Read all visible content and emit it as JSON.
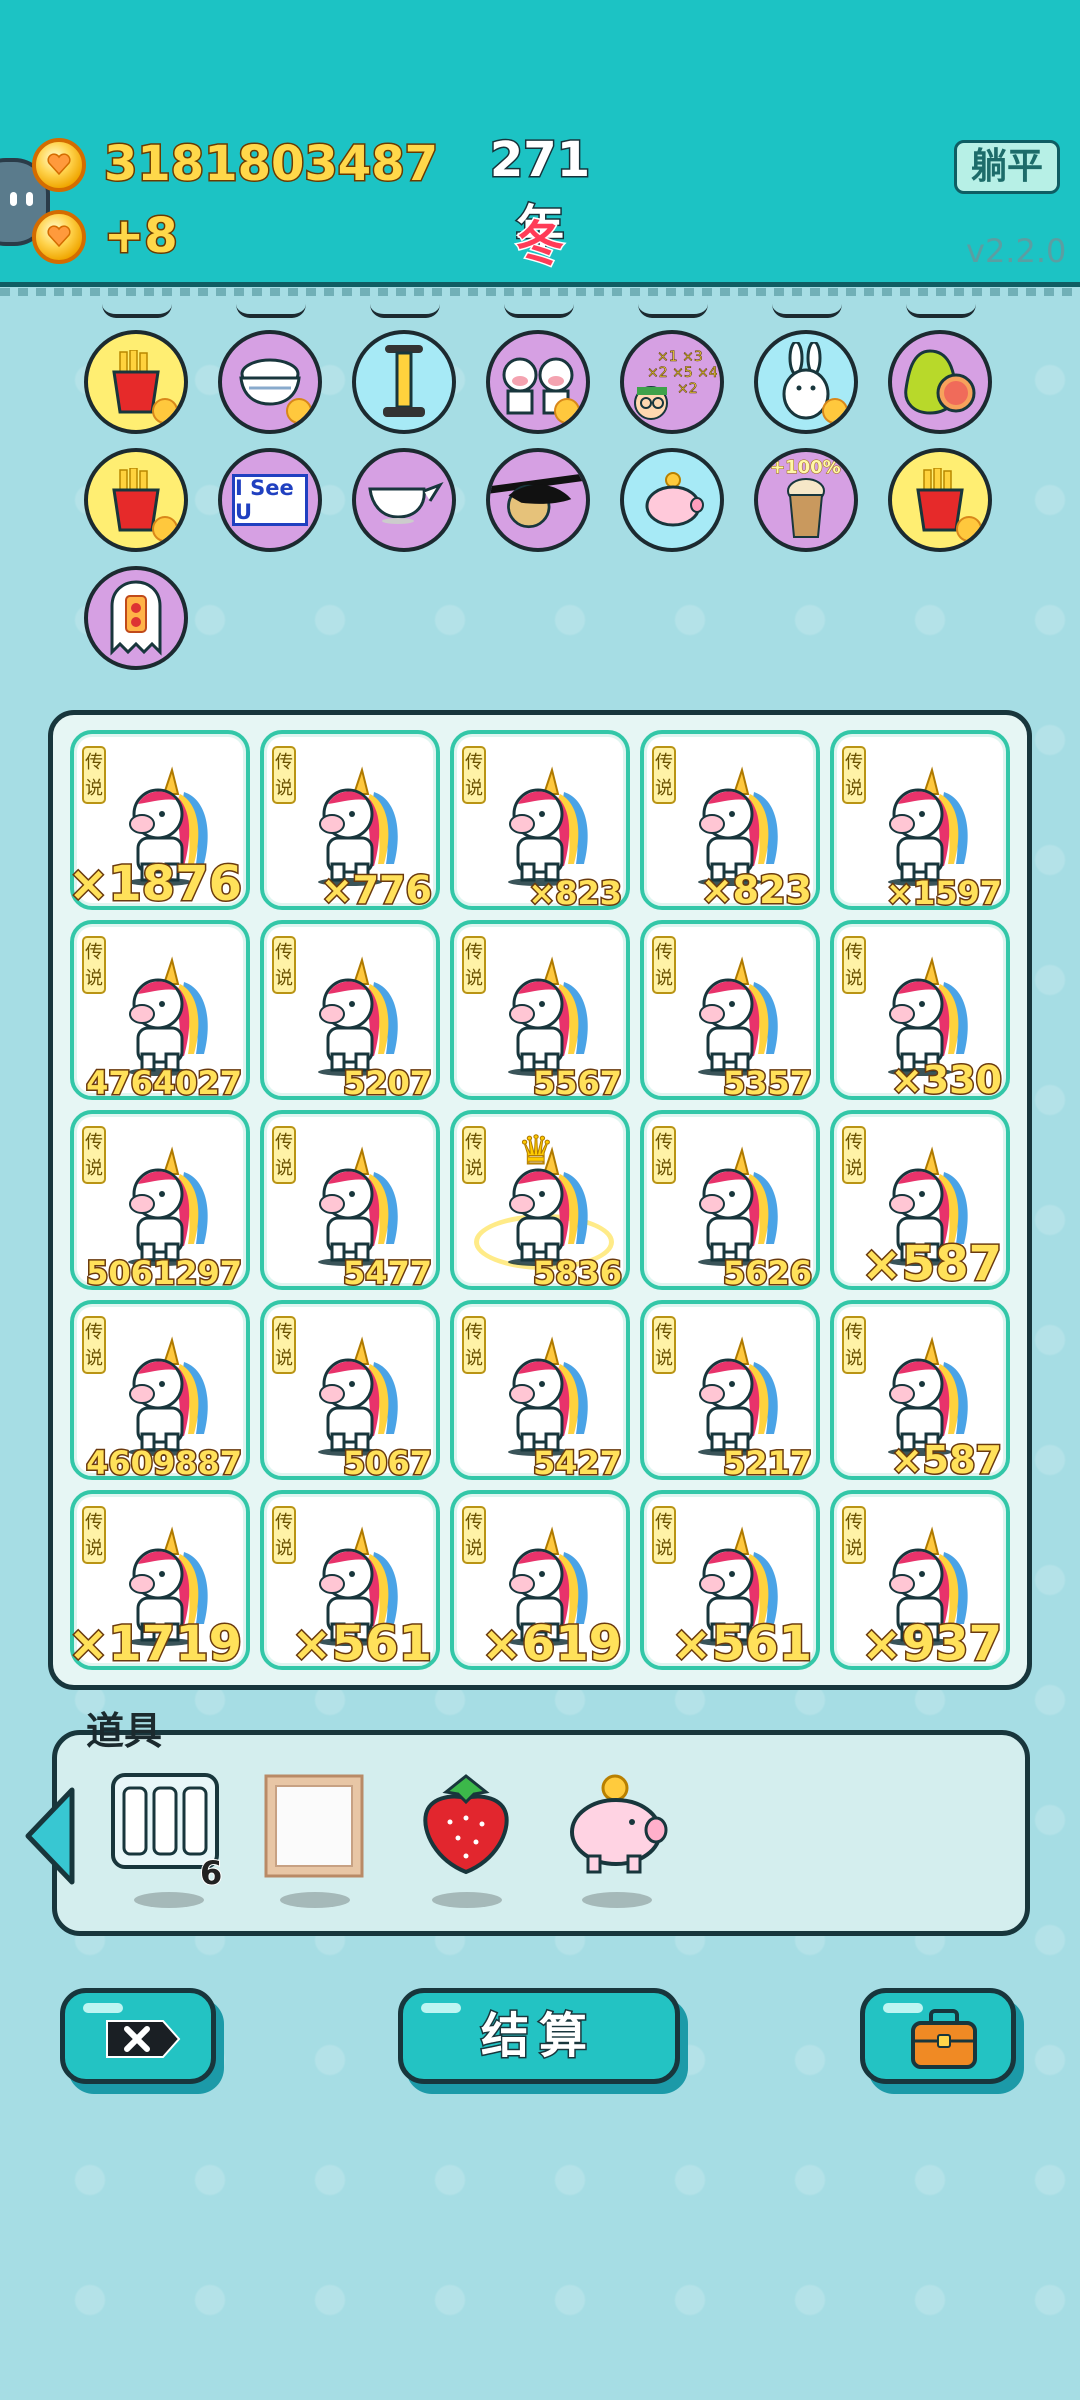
{
  "header": {
    "coins": "3181803487",
    "income": "+8",
    "year": "271年",
    "season": "冬",
    "lie_flat_button": "躺平",
    "version": "v2.2.0"
  },
  "buffs": [
    {
      "icon": "fries-icon",
      "color": "yellow",
      "heart": true
    },
    {
      "icon": "rice-bowl-icon",
      "color": "purple",
      "heart": true
    },
    {
      "icon": "air-pump-icon",
      "color": "blue",
      "heart": false
    },
    {
      "icon": "cow-couple-icon",
      "color": "purple",
      "heart": true
    },
    {
      "icon": "math-nerd-icon",
      "color": "purple",
      "heart": false
    },
    {
      "icon": "rabbit-icon",
      "color": "blue",
      "heart": true
    },
    {
      "icon": "pomelo-icon",
      "color": "purple",
      "heart": false
    },
    {
      "icon": "fries-icon",
      "color": "yellow",
      "heart": true
    },
    {
      "icon": "i-see-u-icon",
      "color": "purple",
      "heart": false,
      "text": "I See U"
    },
    {
      "icon": "gravy-boat-icon",
      "color": "purple",
      "heart": false
    },
    {
      "icon": "eyepatch-icon",
      "color": "purple",
      "heart": false
    },
    {
      "icon": "piggy-bank-icon",
      "color": "blue",
      "heart": false
    },
    {
      "icon": "milk-tea-icon",
      "color": "purple",
      "heart": false,
      "text": "+100%"
    },
    {
      "icon": "fries-icon",
      "color": "yellow",
      "heart": true
    },
    {
      "icon": "ghost-icon",
      "color": "purple",
      "heart": false
    }
  ],
  "board": {
    "rarity_label": "传说",
    "cells": [
      {
        "count": "×1876",
        "size": "big"
      },
      {
        "count": "×776",
        "size": "mid"
      },
      {
        "count": "×823",
        "size": "sm"
      },
      {
        "count": "×823",
        "size": "mid"
      },
      {
        "count": "×1597",
        "size": "sm"
      },
      {
        "count": "4764027",
        "size": "sm"
      },
      {
        "count": "5207",
        "size": "sm"
      },
      {
        "count": "5567",
        "size": "sm"
      },
      {
        "count": "5357",
        "size": "sm"
      },
      {
        "count": "×330",
        "size": "mid"
      },
      {
        "count": "5061297",
        "size": "sm"
      },
      {
        "count": "5477",
        "size": "sm"
      },
      {
        "count": "5836",
        "size": "sm",
        "crowned": true
      },
      {
        "count": "5626",
        "size": "sm"
      },
      {
        "count": "×587",
        "size": "big"
      },
      {
        "count": "4609887",
        "size": "sm"
      },
      {
        "count": "5067",
        "size": "sm"
      },
      {
        "count": "5427",
        "size": "sm"
      },
      {
        "count": "5217",
        "size": "sm"
      },
      {
        "count": "×587",
        "size": "mid"
      },
      {
        "count": "×1719",
        "size": "big"
      },
      {
        "count": "×561",
        "size": "big"
      },
      {
        "count": "×619",
        "size": "big"
      },
      {
        "count": "×561",
        "size": "big"
      },
      {
        "count": "×937",
        "size": "big"
      }
    ]
  },
  "items": {
    "label": "道具",
    "list": [
      {
        "icon": "triple-slot-icon",
        "count": "6"
      },
      {
        "icon": "wooden-frame-icon"
      },
      {
        "icon": "strawberry-icon"
      },
      {
        "icon": "piggy-bank-icon"
      }
    ]
  },
  "buttons": {
    "settle": "结算"
  },
  "colors": {
    "header_bg": "#1cc3c4",
    "page_bg": "#a6dde4",
    "cell_border": "#33c7a8",
    "count_text": "#ffe15a"
  }
}
